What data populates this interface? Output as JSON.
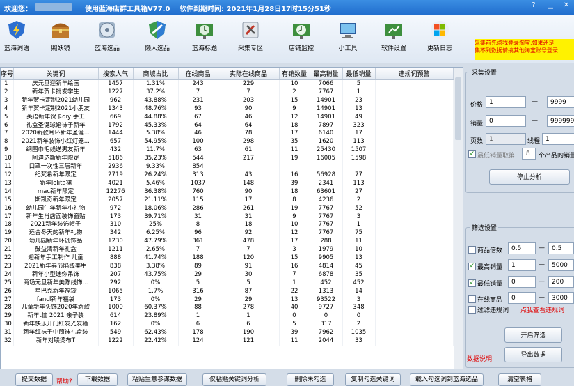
{
  "title_bar": {
    "welcome": "欢迎您：",
    "app_title": "使用蓝海店群工具箱V77.0",
    "expiry": "软件到期时间: 2021年1月28日17时15分51秒"
  },
  "toolbar": [
    {
      "label": "蓝海词语",
      "icon": "lightning-shield-icon"
    },
    {
      "label": "照妖镜",
      "icon": "treasure-chest-icon"
    },
    {
      "label": "蓝海选品",
      "icon": "cd-disc-icon"
    },
    {
      "label": "懒人选品",
      "icon": "green-shield-icon"
    },
    {
      "label": "蓝海标题",
      "icon": "clock-board-icon"
    },
    {
      "label": "采集专区",
      "icon": "tools-icon"
    },
    {
      "label": "店铺监控",
      "icon": "monitor-clock-icon"
    },
    {
      "label": "小工具",
      "icon": "computer-screen-icon"
    },
    {
      "label": "软件设置",
      "icon": "settings-board-icon"
    },
    {
      "label": "更新日志",
      "icon": "windows-logo-icon"
    }
  ],
  "notice": {
    "line1": "采集前先点我登录淘宝,如果还是",
    "line2": "集不到数据请搞其他淘宝账号登录"
  },
  "table": {
    "columns": [
      "序号",
      "关键词",
      "搜索人气",
      "商城占比",
      "在线商品",
      "实际在线商品",
      "有销数量",
      "最高销量",
      "最低销量",
      "违规词预警"
    ],
    "rows": [
      [
        "1",
        "庆元旦迎新年绘画",
        "1457",
        "1.31%",
        "243",
        "229",
        "10",
        "7066",
        "5"
      ],
      [
        "2",
        "新年贺卡批发学生",
        "1227",
        "37.2%",
        "7",
        "7",
        "2",
        "7767",
        "1"
      ],
      [
        "3",
        "新年贺卡定制2021幼儿园",
        "962",
        "43.88%",
        "231",
        "203",
        "15",
        "14901",
        "23"
      ],
      [
        "4",
        "新年贺卡定制2021小朋友",
        "1343",
        "48.76%",
        "93",
        "90",
        "9",
        "14901",
        "13"
      ],
      [
        "5",
        "英语新年贺卡diy 手工",
        "669",
        "44.88%",
        "67",
        "46",
        "12",
        "14901",
        "49"
      ],
      [
        "6",
        "礼盒圣诞球婚袜子新年",
        "1792",
        "45.33%",
        "64",
        "64",
        "18",
        "7897",
        "323"
      ],
      [
        "7",
        "2020新款耳环新年圣诞...",
        "1444",
        "5.38%",
        "46",
        "78",
        "17",
        "6140",
        "17"
      ],
      [
        "8",
        "2021新年装饰小红灯笼...",
        "657",
        "54.95%",
        "100",
        "298",
        "35",
        "1620",
        "113"
      ],
      [
        "9",
        "纲围巾毛线送男友新年",
        "432",
        "11.7%",
        "63",
        "61",
        "11",
        "25430",
        "1507"
      ],
      [
        "10",
        "阿迪达斯新年限定",
        "5186",
        "35.23%",
        "544",
        "217",
        "19",
        "16005",
        "1598"
      ],
      [
        "11",
        "口罩一次性三层新年",
        "2936",
        "9.33%",
        "854",
        "",
        "",
        "",
        ""
      ],
      [
        "12",
        "纪梵希新年限定",
        "2719",
        "26.24%",
        "313",
        "43",
        "16",
        "56928",
        "77"
      ],
      [
        "13",
        "新年lolita裙",
        "4021",
        "5.46%",
        "1037",
        "148",
        "39",
        "2341",
        "113"
      ],
      [
        "14",
        "mac新年限定",
        "12276",
        "36.38%",
        "760",
        "90",
        "18",
        "63601",
        "27"
      ],
      [
        "15",
        "斯凯奇新年限定",
        "2057",
        "21.11%",
        "115",
        "17",
        "8",
        "4236",
        "2"
      ],
      [
        "16",
        "幼儿园牛年新年小礼物",
        "972",
        "18.06%",
        "286",
        "261",
        "19",
        "7767",
        "52"
      ],
      [
        "17",
        "新年生肖店面装饰窗贴",
        "173",
        "39.71%",
        "31",
        "31",
        "9",
        "7767",
        "3"
      ],
      [
        "18",
        "2021新年装饰帽子",
        "310",
        "25%",
        "8",
        "18",
        "10",
        "7767",
        "1"
      ],
      [
        "19",
        "适合冬天的新年礼物",
        "342",
        "6.25%",
        "96",
        "92",
        "12",
        "7767",
        "75"
      ],
      [
        "20",
        "幼儿园新年环创饰品",
        "1230",
        "47.79%",
        "361",
        "478",
        "17",
        "288",
        "11"
      ],
      [
        "21",
        "鼓益清新年礼盒",
        "1211",
        "2.65%",
        "7",
        "7",
        "3",
        "1979",
        "10"
      ],
      [
        "22",
        "迎新年手工制作 儿童",
        "888",
        "41.74%",
        "188",
        "120",
        "15",
        "9905",
        "13"
      ],
      [
        "23",
        "2021新年春节陷线美甲",
        "838",
        "3.38%",
        "89",
        "91",
        "16",
        "4814",
        "45"
      ],
      [
        "24",
        "新年小型迷你吊饰",
        "207",
        "43.75%",
        "29",
        "30",
        "7",
        "6878",
        "35"
      ],
      [
        "25",
        "商场元旦新年美陈线饰...",
        "292",
        "0%",
        "5",
        "5",
        "1",
        "452",
        "452"
      ],
      [
        "26",
        "星巴克新年福袋",
        "1065",
        "1.7%",
        "316",
        "87",
        "22",
        "1313",
        "14"
      ],
      [
        "27",
        "fancl新年福袋",
        "173",
        "0%",
        "29",
        "29",
        "13",
        "93522",
        "3"
      ],
      [
        "28",
        "儿童新年头饰2020年新款",
        "1000",
        "60.37%",
        "88",
        "278",
        "40",
        "9727",
        "348"
      ],
      [
        "29",
        "新年t恤 2021 亲子装",
        "614",
        "23.89%",
        "1",
        "1",
        "0",
        "0",
        "0"
      ],
      [
        "30",
        "新年快乐开门红发光发箍",
        "162",
        "0%",
        "6",
        "6",
        "5",
        "317",
        "2"
      ],
      [
        "31",
        "新年红袜子中筒袜礼盒装",
        "549",
        "62.43%",
        "178",
        "190",
        "39",
        "7962",
        "1035"
      ],
      [
        "32",
        "新年对联烫布T",
        "1222",
        "22.42%",
        "124",
        "121",
        "11",
        "2044",
        "33"
      ]
    ]
  },
  "collect": {
    "group_title": "采集设置",
    "price_label": "价格:",
    "price_min": "1",
    "price_max": "9999",
    "sales_label": "销量:",
    "sales_min": "0",
    "sales_max": "999999",
    "pages_label": "页数:",
    "pages_value": "1",
    "thread_label": "线程",
    "thread_value": "1",
    "min_sales_check_label": "最低销量取第",
    "min_sales_n": "8",
    "min_sales_suffix": "个产品的销量",
    "stop_button": "停止分析"
  },
  "filter": {
    "group_title": "筛选设置",
    "rows": [
      {
        "label": "商品倍数",
        "checked": false,
        "min": "0.5",
        "max": "0.5"
      },
      {
        "label": "最高销量",
        "checked": true,
        "min": "1",
        "max": "5000"
      },
      {
        "label": "最低销量",
        "checked": true,
        "min": "0",
        "max": "200"
      },
      {
        "label": "在线商品",
        "checked": false,
        "min": "0",
        "max": "3000"
      }
    ],
    "violation_label": "过滤违规词",
    "violation_link": "点我查看违规词",
    "start_button": "开启筛选",
    "data_note": "数据说明",
    "export_button": "导出数据"
  },
  "bottom": [
    "提交数据",
    "帮助?",
    "下载数据",
    "粘贴生意参谋数据",
    "仅粘贴关键词分析",
    "删除未勾选",
    "复制勾选关键词",
    "载入勾选词到蓝海选品",
    "清空表格"
  ],
  "colors": {
    "title_bar": "#2a7bd8",
    "notice_bg": "#fff200",
    "notice_text": "#e00000",
    "link_red": "#e00000",
    "check_green": "#1b8a1b"
  }
}
